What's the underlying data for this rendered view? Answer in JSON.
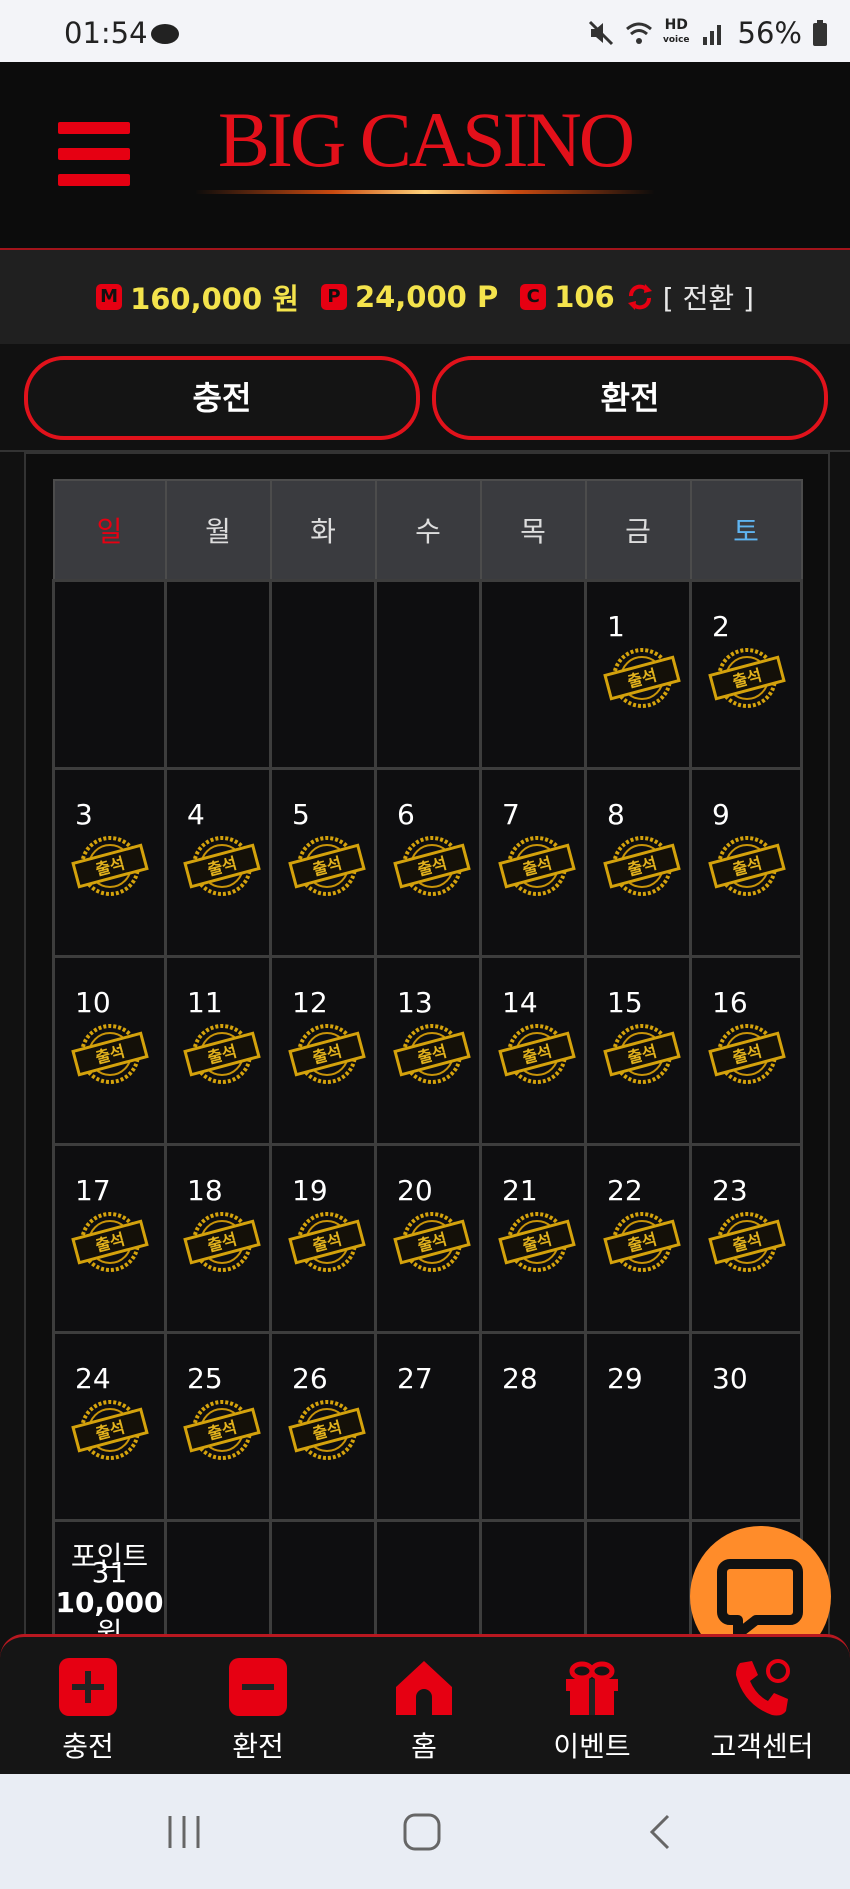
{
  "status_bar": {
    "time": "01:54",
    "battery": "56%",
    "hd_label": "HD",
    "voice_label": "voice"
  },
  "header": {
    "logo": "BIG CASINO"
  },
  "balance": {
    "m_badge": "M",
    "money": "160,000 원",
    "p_badge": "P",
    "points": "24,000 P",
    "c_badge": "C",
    "coins": "106",
    "exchange": "[ 전환 ]"
  },
  "actions": {
    "charge": "충전",
    "withdraw": "환전"
  },
  "calendar": {
    "weekdays": [
      "일",
      "월",
      "화",
      "수",
      "목",
      "금",
      "토"
    ],
    "stamp_label": "출석",
    "weeks": [
      [
        "",
        "",
        "",
        "",
        "",
        "1",
        "2"
      ],
      [
        "3",
        "4",
        "5",
        "6",
        "7",
        "8",
        "9"
      ],
      [
        "10",
        "11",
        "12",
        "13",
        "14",
        "15",
        "16"
      ],
      [
        "17",
        "18",
        "19",
        "20",
        "21",
        "22",
        "23"
      ],
      [
        "24",
        "25",
        "26",
        "27",
        "28",
        "29",
        "30"
      ]
    ],
    "stamped_days": [
      "1",
      "2",
      "3",
      "4",
      "5",
      "6",
      "7",
      "8",
      "9",
      "10",
      "11",
      "12",
      "13",
      "14",
      "15",
      "16",
      "17",
      "18",
      "19",
      "20",
      "21",
      "22",
      "23",
      "24",
      "25",
      "26"
    ],
    "last_row": {
      "point_label": "포인트",
      "day": "31",
      "amount": "10,000",
      "unit": "원"
    },
    "colors": {
      "sunday": "#e60012",
      "saturday": "#5fb4f0",
      "stamp": "#d4a20c"
    }
  },
  "bottom_nav": [
    {
      "label": "충전",
      "icon": "plus-icon"
    },
    {
      "label": "환전",
      "icon": "minus-icon"
    },
    {
      "label": "홈",
      "icon": "home-icon"
    },
    {
      "label": "이벤트",
      "icon": "gift-icon"
    },
    {
      "label": "고객센터",
      "icon": "phone-icon"
    }
  ]
}
